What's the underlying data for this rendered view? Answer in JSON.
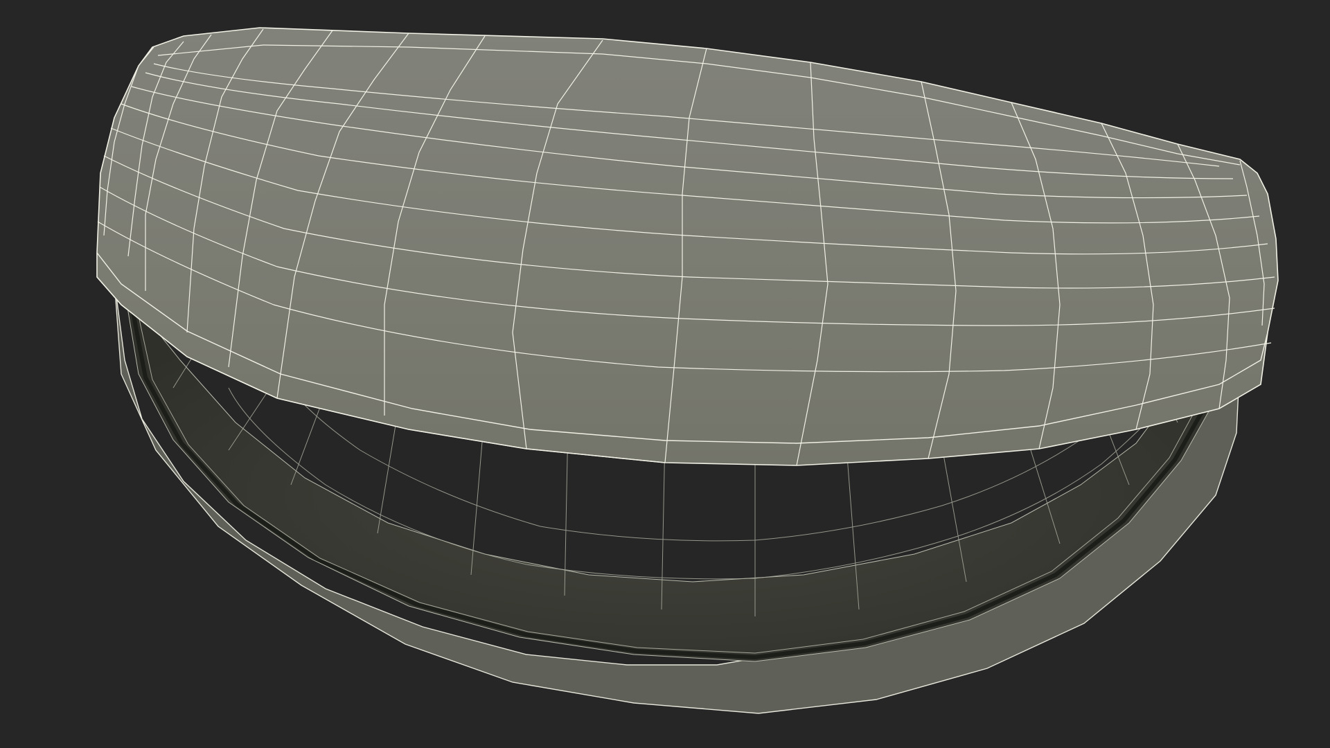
{
  "scene": {
    "subject": "open-eyeglass-case-wireframe",
    "colors": {
      "background": "#262626",
      "lid_fill": "#7b7c72",
      "lid_fill_shade": "#6f7067",
      "wire": "#f2f1e6",
      "interior_fill": "#3b3c35",
      "interior_wire": "#a9aa9d",
      "rim_fill": "#6a6b62",
      "rim_inner": "#1f211d"
    }
  }
}
